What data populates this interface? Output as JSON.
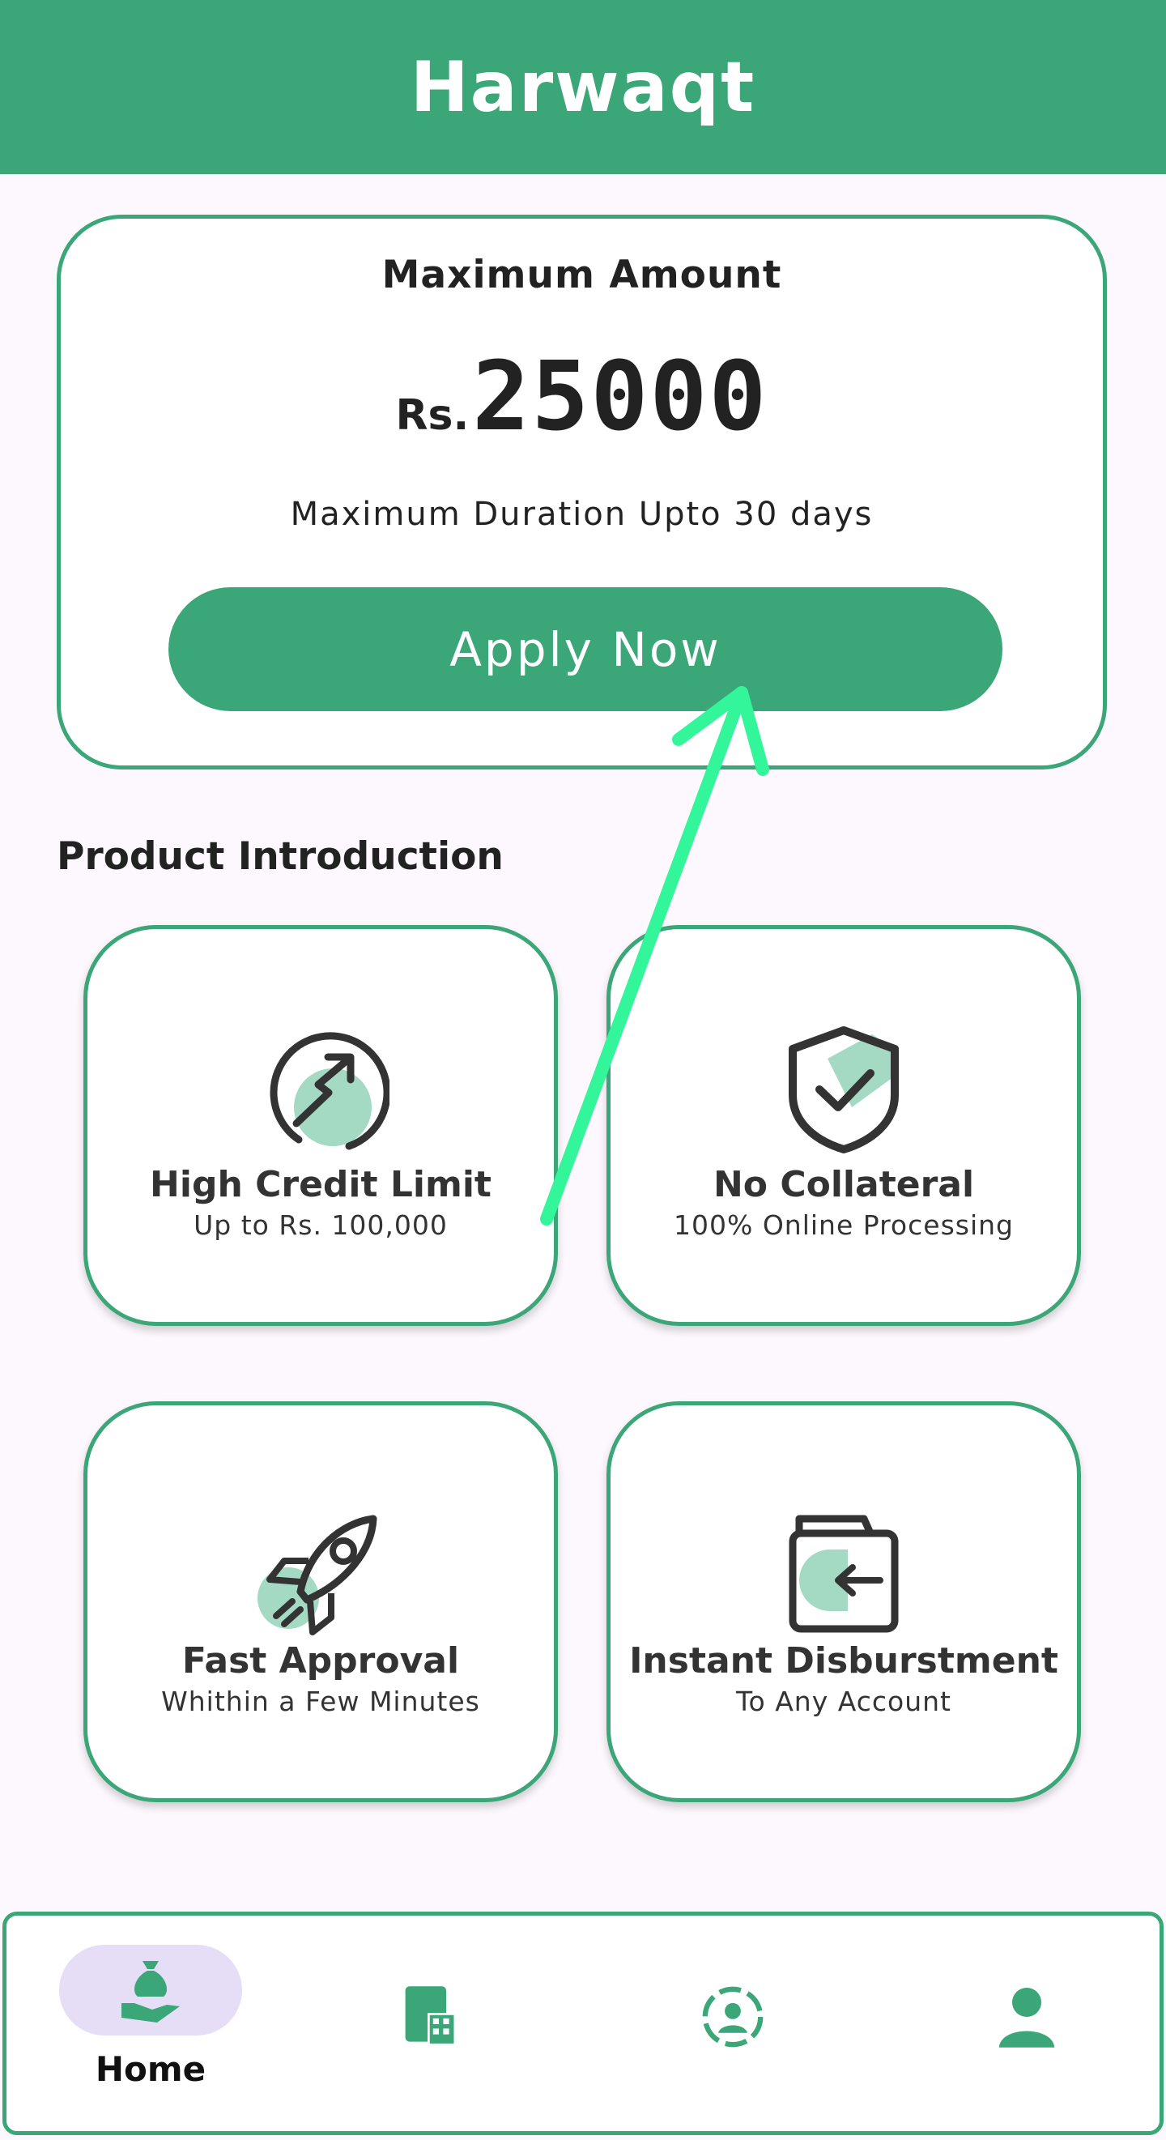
{
  "app": {
    "title": "Harwaqt"
  },
  "loan": {
    "heading": "Maximum Amount",
    "currency": "Rs.",
    "amount": "25000",
    "duration": "Maximum Duration Upto 30 days",
    "apply_label": "Apply Now"
  },
  "section": {
    "title": "Product Introduction"
  },
  "features": [
    {
      "title": "High Credit Limit",
      "subtitle": "Up to Rs. 100,000",
      "icon": "credit-growth-icon"
    },
    {
      "title": "No Collateral",
      "subtitle": "100% Online Processing",
      "icon": "shield-check-icon"
    },
    {
      "title": "Fast Approval",
      "subtitle": "Whithin a Few Minutes",
      "icon": "rocket-icon"
    },
    {
      "title": "Instant Disburstment",
      "subtitle": "To Any Account",
      "icon": "wallet-transfer-icon"
    }
  ],
  "nav": {
    "items": [
      {
        "label": "Home",
        "icon": "money-bag-hand-icon",
        "active": true
      },
      {
        "label": "",
        "icon": "building-icon",
        "active": false
      },
      {
        "label": "",
        "icon": "user-scan-icon",
        "active": false
      },
      {
        "label": "",
        "icon": "person-icon",
        "active": false
      }
    ]
  },
  "colors": {
    "primary": "#3ba677",
    "background": "#fdf8fd",
    "nav_active_pill": "#e6def7",
    "icon_fill": "#94d2b8",
    "annotation_arrow": "#33f59a"
  }
}
